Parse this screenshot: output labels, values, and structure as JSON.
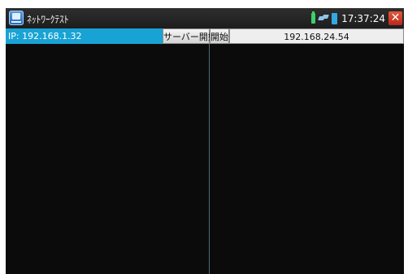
{
  "titlebar": {
    "title": "ﾈｯﾄﾜｰｸﾃｽﾄ",
    "app_icon": "network-tester-icon",
    "time": "17:37:24",
    "close_icon": "close-x-icon",
    "status_icons": [
      "battery-icon",
      "network-link-icon",
      "storage-icon"
    ]
  },
  "toolbar": {
    "ip_label": "IP: 192.168.1.32",
    "server_start_label": "サーバー開始",
    "start_label": "開始",
    "target_ip": "192.168.24.54"
  },
  "colors": {
    "accent": "#19a3d5",
    "background": "#0b0b0b",
    "titlebar": "#262626",
    "close": "#c8321f"
  }
}
